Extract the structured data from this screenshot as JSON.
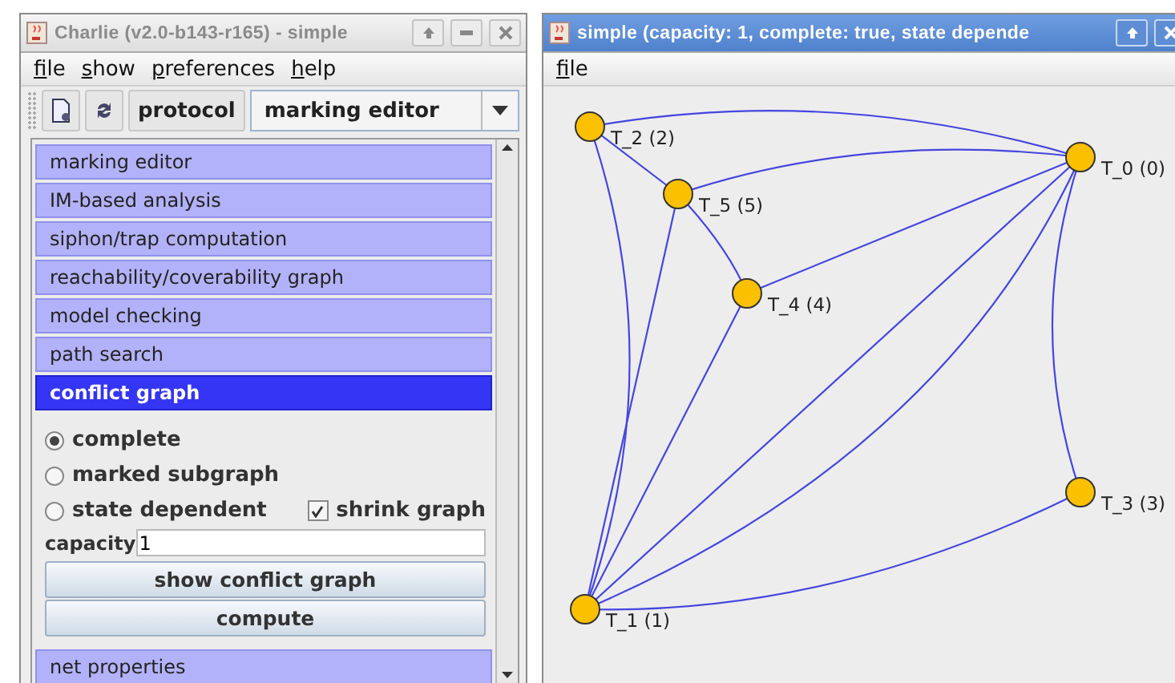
{
  "left_window": {
    "title": "Charlie (v2.0-b143-r165) - simple",
    "menu": [
      "file",
      "show",
      "preferences",
      "help"
    ],
    "toolbar": {
      "protocol_button": "protocol",
      "view_select": "marking editor"
    },
    "sections": [
      {
        "label": "marking editor",
        "selected": false
      },
      {
        "label": "IM-based analysis",
        "selected": false
      },
      {
        "label": "siphon/trap computation",
        "selected": false
      },
      {
        "label": "reachability/coverability graph",
        "selected": false
      },
      {
        "label": "model checking",
        "selected": false
      },
      {
        "label": "path search",
        "selected": false
      },
      {
        "label": "conflict graph",
        "selected": true
      }
    ],
    "conflict_options": {
      "modes": [
        {
          "label": "complete",
          "selected": true
        },
        {
          "label": "marked subgraph",
          "selected": false
        },
        {
          "label": "state dependent",
          "selected": false
        }
      ],
      "shrink_graph": {
        "label": "shrink graph",
        "checked": true
      },
      "capacity": {
        "label": "capacity",
        "value": "1"
      },
      "buttons": [
        "show conflict graph",
        "compute"
      ]
    },
    "bottom_sections": [
      {
        "label": "net properties",
        "selected": false
      }
    ]
  },
  "right_window": {
    "title": "simple (capacity: 1, complete: true, state depende",
    "menu": [
      "file"
    ],
    "nodes": [
      {
        "label": "T_2 (2)"
      },
      {
        "label": "T_5 (5)"
      },
      {
        "label": "T_0 (0)"
      },
      {
        "label": "T_4 (4)"
      },
      {
        "label": "T_3 (3)"
      },
      {
        "label": "T_1 (1)"
      }
    ]
  }
}
